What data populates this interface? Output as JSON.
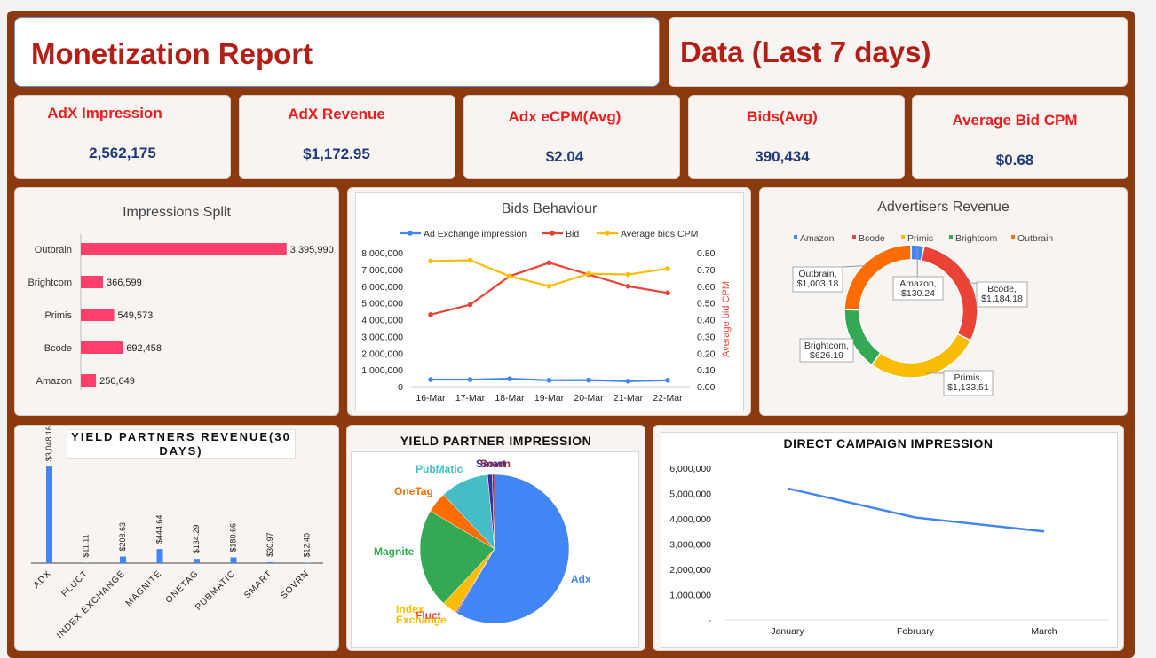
{
  "header": {
    "title": "Monetization Report",
    "subtitle": "Data (Last 7 days)"
  },
  "kpis": [
    {
      "label": "AdX Impression",
      "value": "2,562,175"
    },
    {
      "label": "AdX Revenue",
      "value": "$1,172.95"
    },
    {
      "label": "Adx eCPM(Avg)",
      "value": "$2.04"
    },
    {
      "label": "Bids(Avg)",
      "value": "390,434"
    },
    {
      "label": "Average Bid CPM",
      "value": "$0.68"
    }
  ],
  "colors": {
    "frame": "#8b3a0f",
    "title_red": "#b31f17",
    "kpi_label": "#ee1c1c",
    "kpi_value": "#1f3a7a",
    "pink_bar": "#fd3f6c",
    "blue": "#4285f4",
    "red": "#ea4335",
    "yellow": "#fbbc04",
    "green": "#34a853",
    "orange": "#ff6d01",
    "teal": "#46bdc6"
  },
  "chart_data": [
    {
      "id": "impressions_split",
      "type": "bar",
      "orientation": "horizontal",
      "title": "Impressions Split",
      "categories": [
        "Outbrain",
        "Brightcom",
        "Primis",
        "Bcode",
        "Amazon"
      ],
      "values": [
        3395990,
        366599,
        549573,
        692458,
        250649
      ],
      "labels": [
        "3,395,990",
        "366,599",
        "549,573",
        "692,458",
        "250,649"
      ],
      "xlim": [
        0,
        4000000
      ]
    },
    {
      "id": "bids_behaviour",
      "type": "line",
      "title": "Bids Behaviour",
      "x": [
        "16-Mar",
        "17-Mar",
        "18-Mar",
        "19-Mar",
        "20-Mar",
        "21-Mar",
        "22-Mar"
      ],
      "series": [
        {
          "name": "Ad Exchange impression",
          "axis": "left",
          "values": [
            420000,
            420000,
            470000,
            380000,
            390000,
            330000,
            380000
          ]
        },
        {
          "name": "Bid",
          "axis": "left",
          "values": [
            4300000,
            4900000,
            6600000,
            7400000,
            6700000,
            6000000,
            5600000
          ]
        },
        {
          "name": "Average bids CPM",
          "axis": "right",
          "values": [
            0.75,
            0.755,
            0.66,
            0.6,
            0.675,
            0.67,
            0.705
          ]
        }
      ],
      "ylim": [
        0,
        8000000
      ],
      "y2lim": [
        0,
        0.8
      ],
      "yticks": [
        "8,000,000",
        "7,000,000",
        "6,000,000",
        "5,000,000",
        "4,000,000",
        "3,000,000",
        "2,000,000",
        "1,000,000",
        "0"
      ],
      "y2ticks": [
        "0.80",
        "0.70",
        "0.60",
        "0.50",
        "0.40",
        "0.30",
        "0.20",
        "0.10",
        "0.00"
      ],
      "y2label": "Average bid CPM",
      "legend": "top"
    },
    {
      "id": "advertisers_revenue",
      "type": "pie",
      "variant": "donut",
      "title": "Advertisers Revenue",
      "categories": [
        "Amazon",
        "Bcode",
        "Primis",
        "Brightcom",
        "Outbrain"
      ],
      "values": [
        130.24,
        1184.18,
        1133.51,
        626.19,
        1003.18
      ],
      "labels": [
        [
          "Amazon,",
          "$130.24"
        ],
        [
          "Bcode,",
          "$1,184.18"
        ],
        [
          "Primis,",
          "$1,133.51"
        ],
        [
          "Brightcom,",
          "$626.19"
        ],
        [
          "Outbrain,",
          "$1,003.18"
        ]
      ],
      "legend": "top"
    },
    {
      "id": "yield_partners_revenue",
      "type": "bar",
      "title": "YIELD PARTNERS REVENUE(30 DAYS)",
      "categories": [
        "ADX",
        "FLUCT",
        "INDEX EXCHANGE",
        "MAGNITE",
        "ONETAG",
        "PUBMATIC",
        "SMART",
        "SOVRN"
      ],
      "values": [
        3048.16,
        11.11,
        208.63,
        444.64,
        134.29,
        180.66,
        30.97,
        12.4
      ],
      "labels": [
        "$3,048.16",
        "$11.11",
        "$208.63",
        "$444.64",
        "$134.29",
        "$180.66",
        "$30.97",
        "$12.40"
      ],
      "ylim": [
        0,
        3500
      ]
    },
    {
      "id": "yield_partner_impression",
      "type": "pie",
      "title": "YIELD PARTNER IMPRESSION",
      "categories": [
        "Adx",
        "Fluct",
        "Index Exchange",
        "Magnite",
        "OneTag",
        "PubMatic",
        "Smart",
        "Sovrn"
      ],
      "values": [
        58.5,
        0.3,
        3.2,
        21.5,
        4.5,
        10.5,
        1.0,
        0.5
      ]
    },
    {
      "id": "direct_campaign_impression",
      "type": "line",
      "title": "DIRECT CAMPAIGN IMPRESSION",
      "x": [
        "January",
        "February",
        "March"
      ],
      "values": [
        5200000,
        4050000,
        3500000
      ],
      "ylim": [
        0,
        6000000
      ],
      "yticks": [
        "6,000,000",
        "5,000,000",
        "4,000,000",
        "3,000,000",
        "2,000,000",
        "1,000,000",
        "-"
      ]
    }
  ]
}
